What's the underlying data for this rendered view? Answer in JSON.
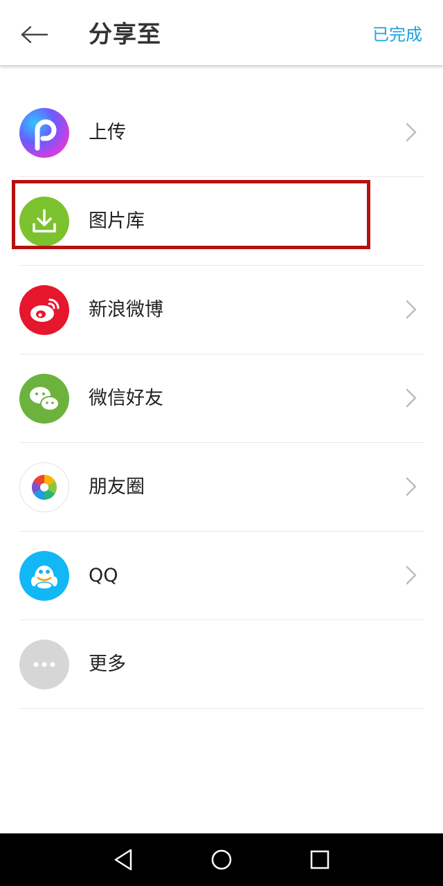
{
  "header": {
    "title": "分享至",
    "done_label": "已完成"
  },
  "share_targets": [
    {
      "label": "上传",
      "icon": "picsart-icon",
      "has_chevron": true
    },
    {
      "label": "图片库",
      "icon": "download-icon",
      "has_chevron": false,
      "highlighted": true
    },
    {
      "label": "新浪微博",
      "icon": "weibo-icon",
      "has_chevron": true
    },
    {
      "label": "微信好友",
      "icon": "wechat-icon",
      "has_chevron": true
    },
    {
      "label": "朋友圈",
      "icon": "moments-icon",
      "has_chevron": true
    },
    {
      "label": "QQ",
      "icon": "qq-icon",
      "has_chevron": true
    },
    {
      "label": "更多",
      "icon": "more-icon",
      "has_chevron": false
    }
  ],
  "colors": {
    "accent": "#1aa2e2",
    "highlight_border": "#b5120f",
    "gallery_green": "#7cc22e",
    "weibo_red": "#e6162d",
    "wechat_green": "#6cb33e",
    "qq_blue": "#12b7f5",
    "more_gray": "#d6d6d6"
  }
}
